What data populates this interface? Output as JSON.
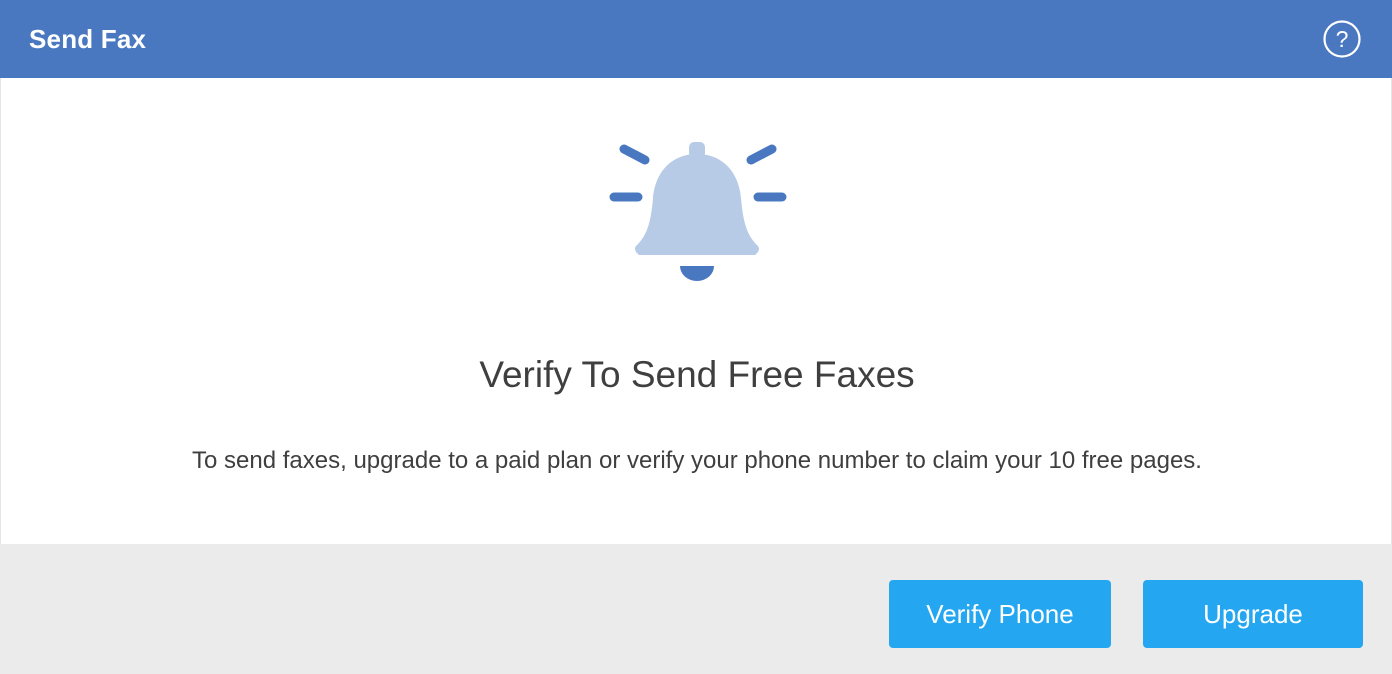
{
  "header": {
    "title": "Send Fax",
    "help_icon": "question-circle-icon"
  },
  "main": {
    "illustration_icon": "bell-ringing-icon",
    "title": "Verify To Send Free Faxes",
    "message": "To send faxes, upgrade to a paid plan or verify your phone number to claim your 10 free pages."
  },
  "footer": {
    "verify_label": "Verify Phone",
    "upgrade_label": "Upgrade"
  },
  "colors": {
    "header_bg": "#4a78c0",
    "bell_body": "#b7cbe7",
    "bell_accent": "#4a78c0",
    "button_bg": "#24a7f0",
    "footer_bg": "#ebebeb",
    "text": "#3f3f3f"
  }
}
